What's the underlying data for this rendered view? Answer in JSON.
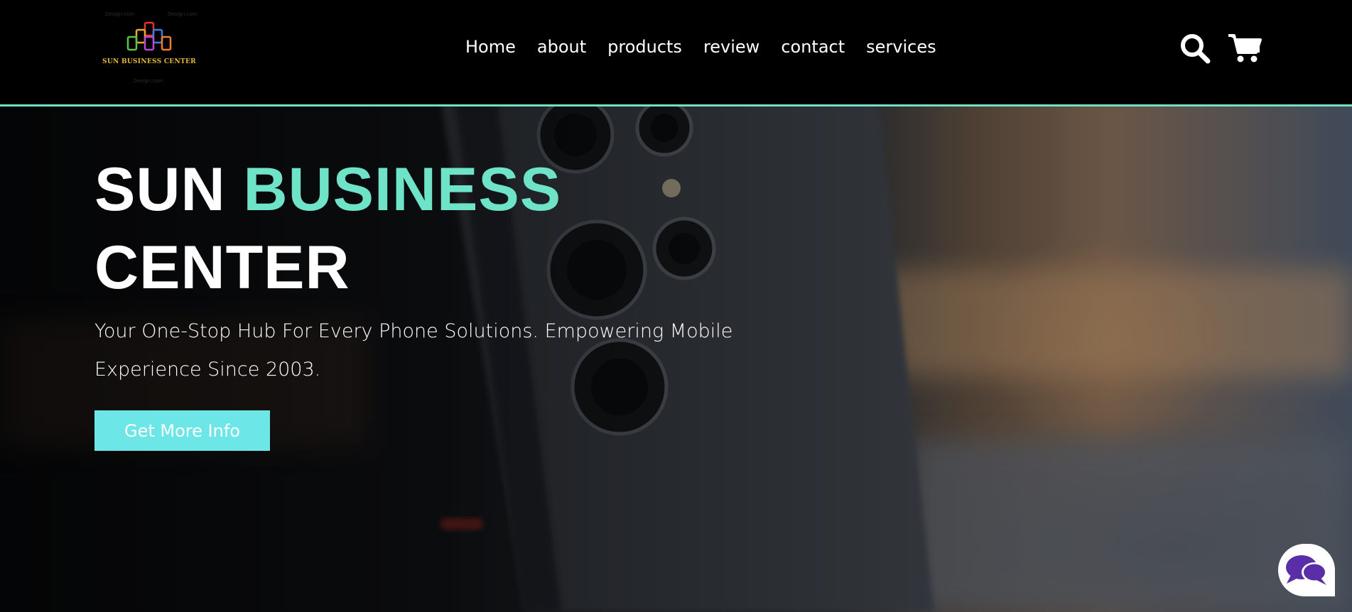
{
  "logo": {
    "brand_text": "SUN BUSINESS CENTER",
    "watermark": "Design.com"
  },
  "nav": {
    "items": [
      {
        "label": "Home"
      },
      {
        "label": "about"
      },
      {
        "label": "products"
      },
      {
        "label": "review"
      },
      {
        "label": "contact"
      },
      {
        "label": "services"
      }
    ]
  },
  "header": {
    "icons": [
      "search-icon",
      "cart-icon"
    ]
  },
  "hero": {
    "title_part1": "SUN ",
    "title_accent": "BUSINESS",
    "title_part2": "CENTER",
    "subtitle": "Your One-Stop Hub For Every Phone Solutions. Empowering Mobile Experience Since 2003.",
    "cta_label": "Get More Info"
  },
  "chat": {
    "icon": "chat-icon"
  },
  "colors": {
    "accent": "#6fe3c8",
    "button": "#6ce6e6",
    "chat_icon": "#5a2ea6",
    "header_bg": "#000000"
  }
}
